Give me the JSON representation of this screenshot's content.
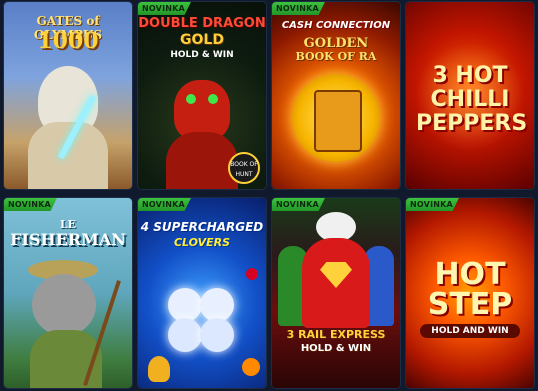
{
  "badge_label": "NOVINKA",
  "tiles": [
    {
      "id": "gates-of-olympus",
      "l1": "GATES of OLYMPUS",
      "l2": "1000",
      "new": false
    },
    {
      "id": "double-dragon-gold",
      "l1": "DOUBLE DRAGON",
      "l2": "GOLD",
      "l3": "HOLD & WIN",
      "sub": "BOOK OF HUNT",
      "new": true
    },
    {
      "id": "cash-connection",
      "l1": "CASH CONNECTION",
      "l2": "GOLDEN",
      "l3": "BOOK OF RA",
      "new": true
    },
    {
      "id": "hot-chilli",
      "l1": "3 HOT CHILLI PEPPERS",
      "new": false
    },
    {
      "id": "le-fisherman",
      "l1": "LE",
      "l2": "FISHERMAN",
      "new": true
    },
    {
      "id": "supercharged-clovers",
      "l1": "4 SUPERCHARGED",
      "l2": "CLOVERS",
      "new": true
    },
    {
      "id": "rail-express",
      "l1": "3 RAIL EXPRESS",
      "l2": "HOLD & WIN",
      "new": true
    },
    {
      "id": "hot-step",
      "l1": "HOT STEP",
      "l2": "HOLD AND WIN",
      "new": true
    }
  ],
  "colors": {
    "background": "#101a2c",
    "badge": "#2fae33"
  }
}
